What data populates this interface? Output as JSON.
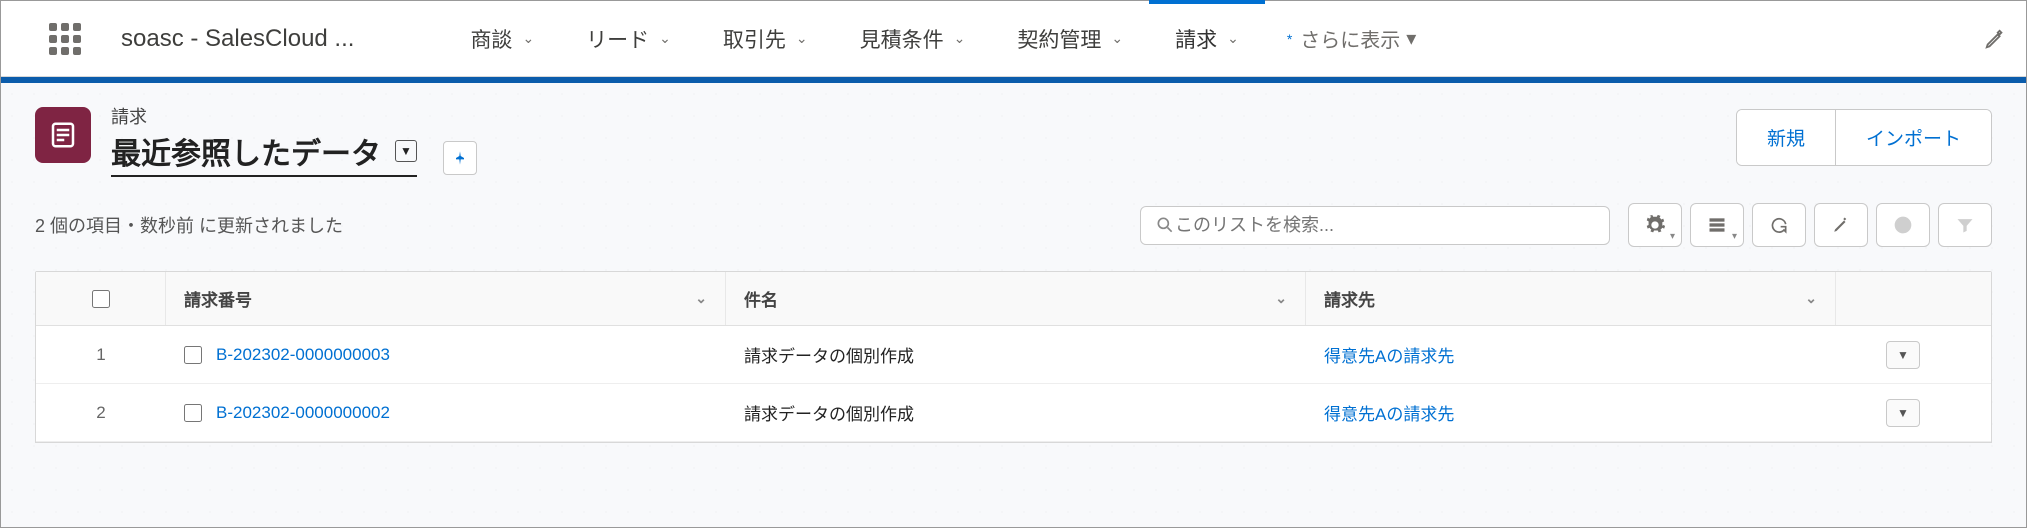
{
  "app_name": "soasc - SalesCloud ...",
  "nav": {
    "tabs": [
      {
        "label": "商談"
      },
      {
        "label": "リード"
      },
      {
        "label": "取引先"
      },
      {
        "label": "見積条件"
      },
      {
        "label": "契約管理"
      },
      {
        "label": "請求",
        "active": true
      }
    ],
    "more_label": "さらに表示"
  },
  "object": {
    "small_label": "請求",
    "view_name": "最近参照したデータ"
  },
  "header_buttons": {
    "new": "新規",
    "import": "インポート"
  },
  "status_text": "2 個の項目・数秒前 に更新されました",
  "search_placeholder": "このリストを検索...",
  "columns": {
    "invoice_no": "請求番号",
    "subject": "件名",
    "bill_to": "請求先"
  },
  "rows": [
    {
      "n": "1",
      "invoice_no": "B-202302-0000000003",
      "subject": "請求データの個別作成",
      "bill_to": "得意先Aの請求先"
    },
    {
      "n": "2",
      "invoice_no": "B-202302-0000000002",
      "subject": "請求データの個別作成",
      "bill_to": "得意先Aの請求先"
    }
  ]
}
